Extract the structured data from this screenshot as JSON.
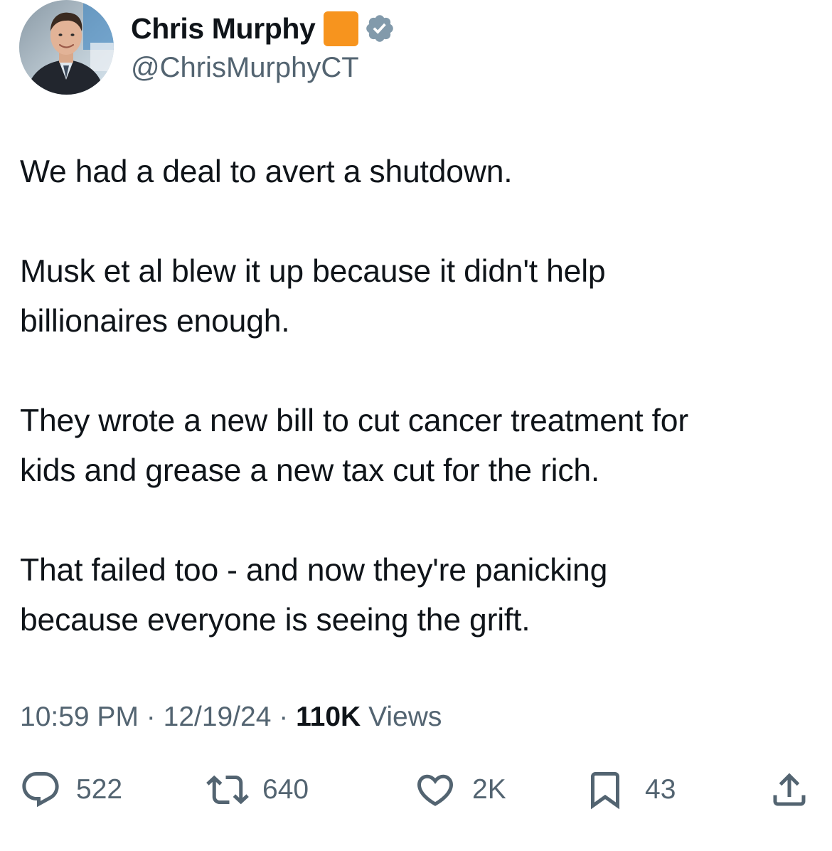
{
  "author": {
    "display_name": "Chris Murphy",
    "handle": "@ChrisMurphyCT",
    "verified": true,
    "badge_emoji_color": "#f7941e",
    "verified_badge_color": "#829aab",
    "avatar_icon": "profile-photo"
  },
  "tweet": {
    "paragraphs": [
      "We had a deal to avert a shutdown.",
      "Musk et al blew it up because it didn't help\nbillionaires enough.",
      "They wrote a new bill to cut cancer treatment for\nkids and grease a new tax cut for the rich.",
      "That failed too - and now they're panicking\nbecause everyone is seeing the grift."
    ]
  },
  "meta": {
    "time": "10:59 PM",
    "separator": "·",
    "date": "12/19/24",
    "views_count": "110K",
    "views_label": "Views"
  },
  "actions": {
    "reply": {
      "icon": "reply-icon",
      "count": "522"
    },
    "retweet": {
      "icon": "retweet-icon",
      "count": "640"
    },
    "like": {
      "icon": "heart-icon",
      "count": "2K"
    },
    "bookmark": {
      "icon": "bookmark-icon",
      "count": "43"
    },
    "share": {
      "icon": "share-icon"
    }
  },
  "colors": {
    "text_primary": "#0f1419",
    "text_secondary": "#536471",
    "background": "#ffffff"
  }
}
